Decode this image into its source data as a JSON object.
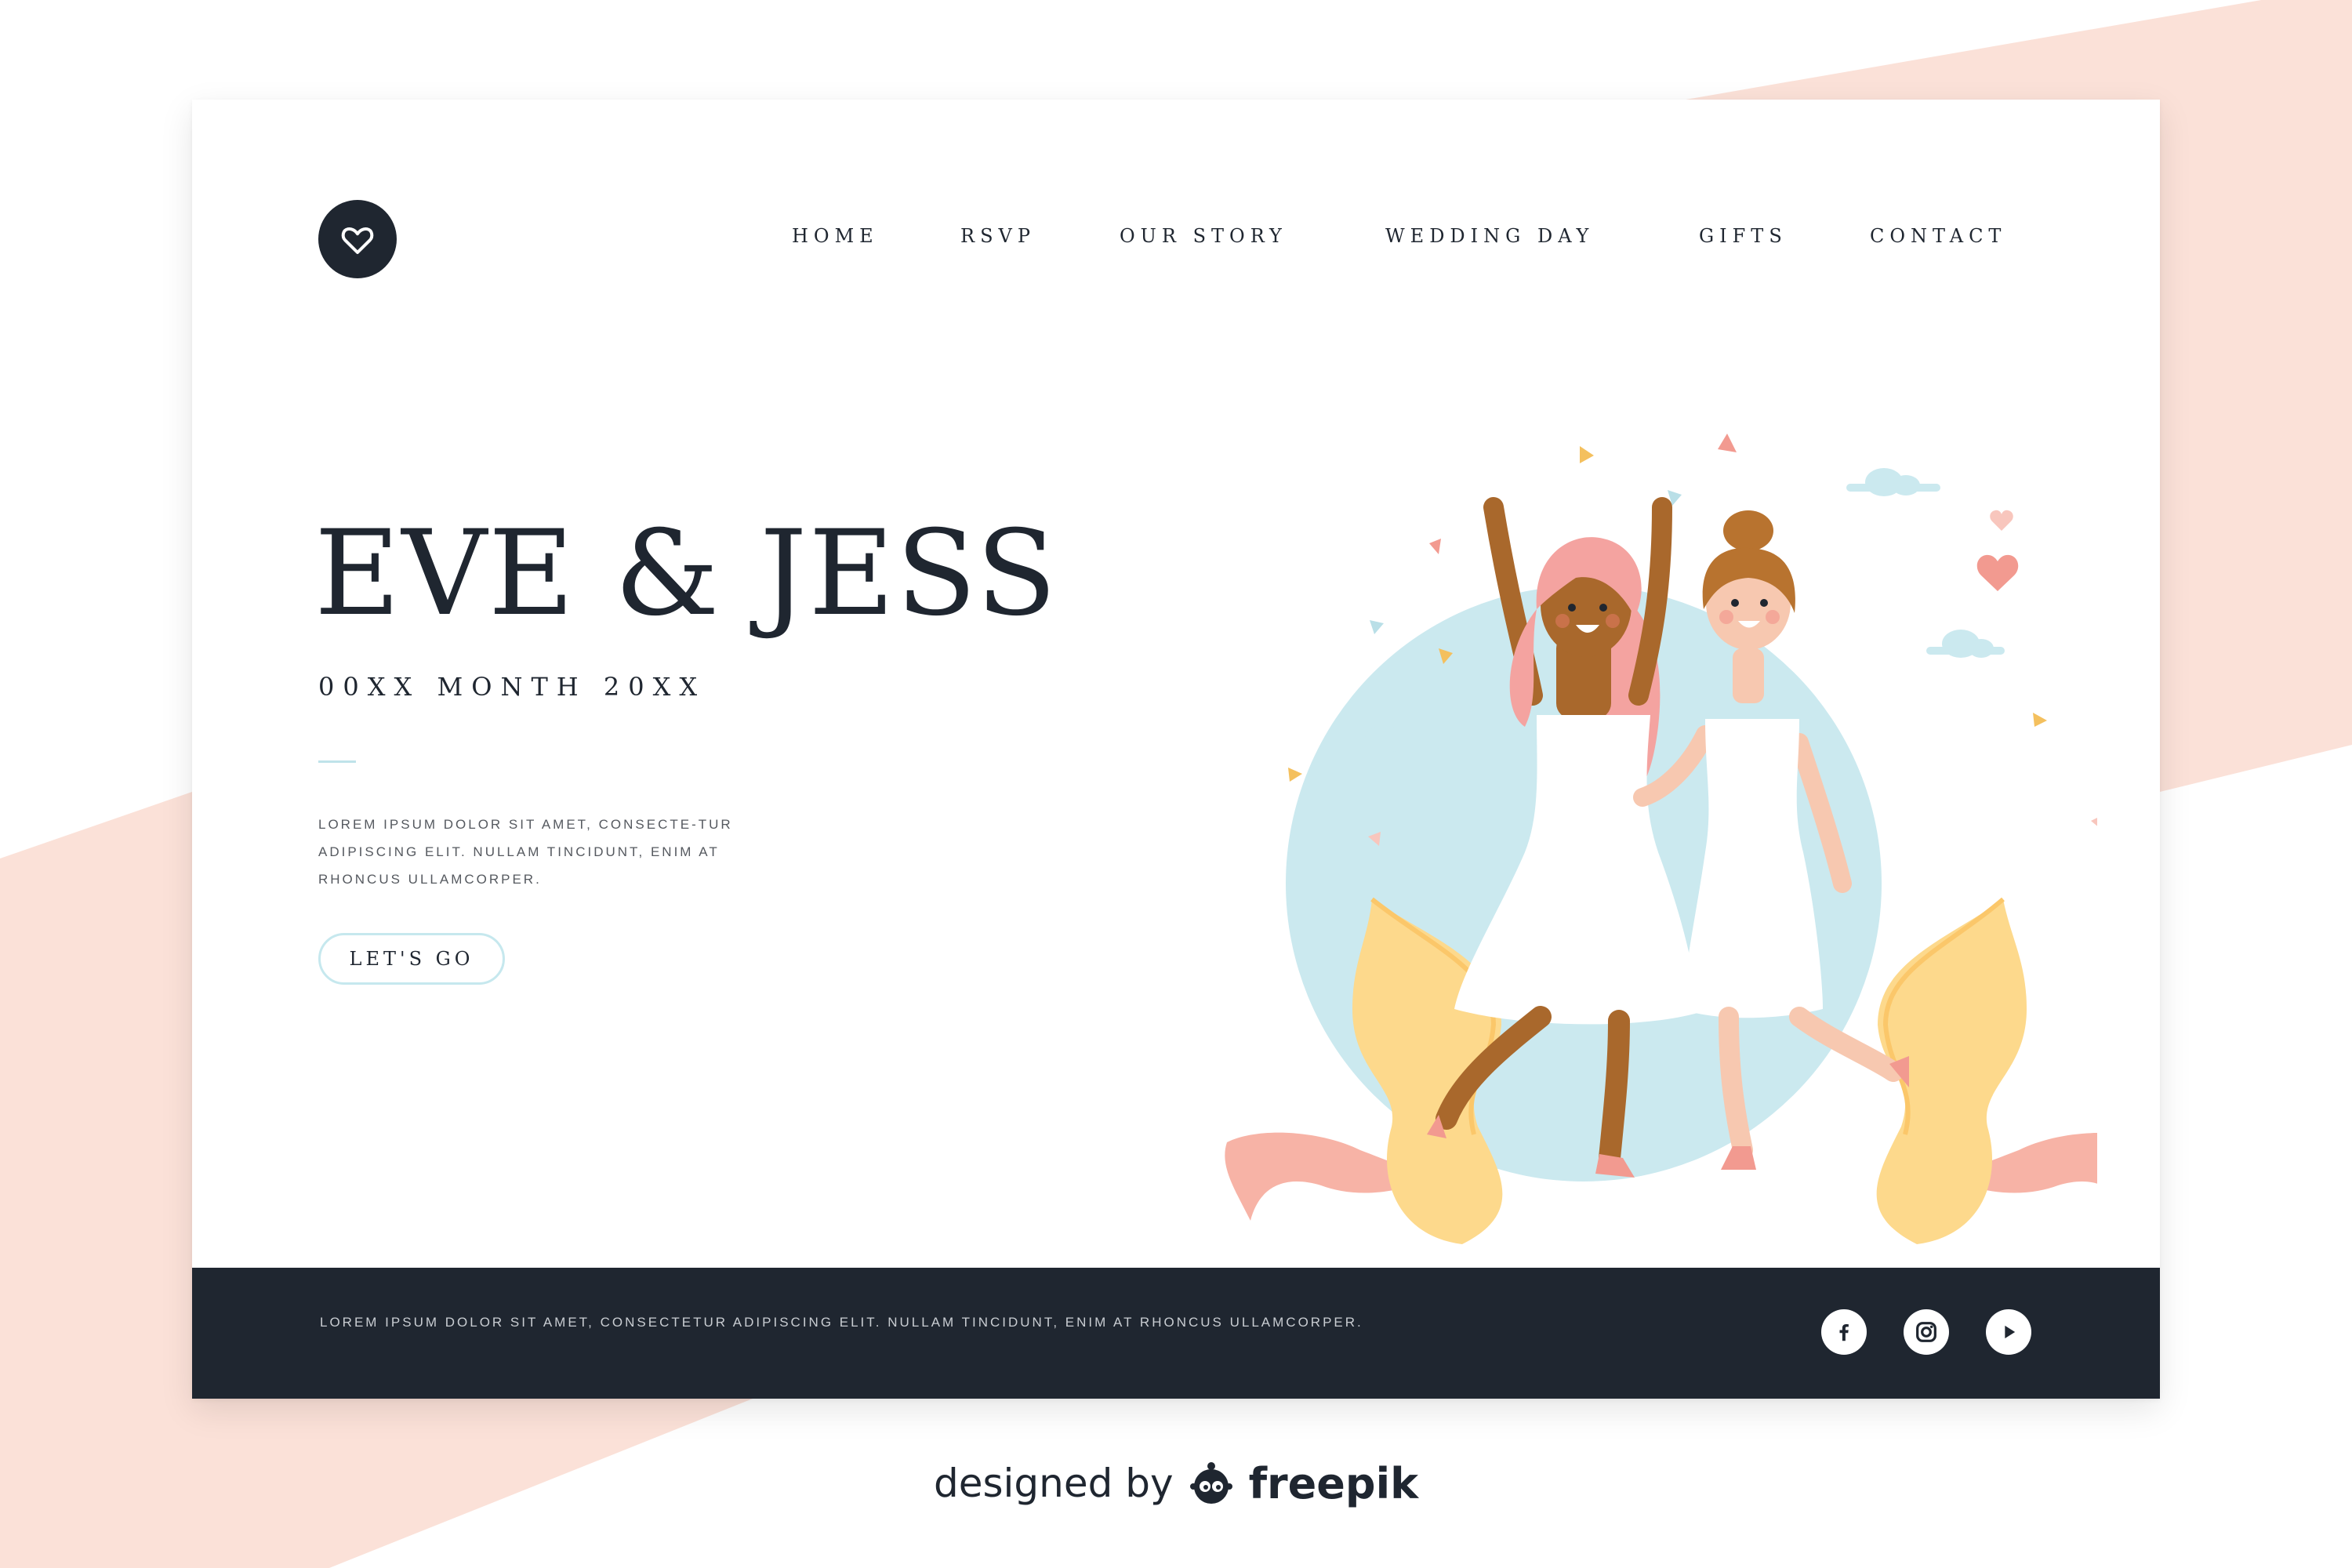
{
  "logo": {
    "icon": "heart-outline-icon"
  },
  "nav": {
    "items": [
      {
        "label": "HOME"
      },
      {
        "label": "RSVP"
      },
      {
        "label": "OUR STORY"
      },
      {
        "label": "WEDDING DAY"
      },
      {
        "label": "GIFTS"
      },
      {
        "label": "CONTACT"
      }
    ]
  },
  "hero": {
    "title": "EVE & JESS",
    "date": "00XX MONTH 20XX",
    "intro": "LOREM IPSUM DOLOR SIT AMET, CONSECTE-TUR ADIPISCING ELIT. NULLAM TINCIDUNT, ENIM AT RHONCUS ULLAMCORPER.",
    "cta_label": "LET'S GO"
  },
  "footer": {
    "text": "LOREM IPSUM DOLOR SIT AMET, CONSECTETUR ADIPISCING ELIT. NULLAM TINCIDUNT, ENIM AT RHONCUS ULLAMCORPER.",
    "social": [
      "facebook-icon",
      "instagram-icon",
      "youtube-icon"
    ]
  },
  "credit": {
    "prefix": "designed by",
    "brand": "freepik"
  },
  "colors": {
    "dark": "#1f2630",
    "peach_background": "#fbe1d8",
    "sky_circle": "#cbe9ef",
    "yellow_leaf": "#fdd98c",
    "pink_leaf": "#f7b3a6",
    "hair_pink": "#f4a3a0",
    "hair_brown": "#b8732f",
    "skin_dark": "#a9682c",
    "skin_light": "#f7c8b0"
  }
}
